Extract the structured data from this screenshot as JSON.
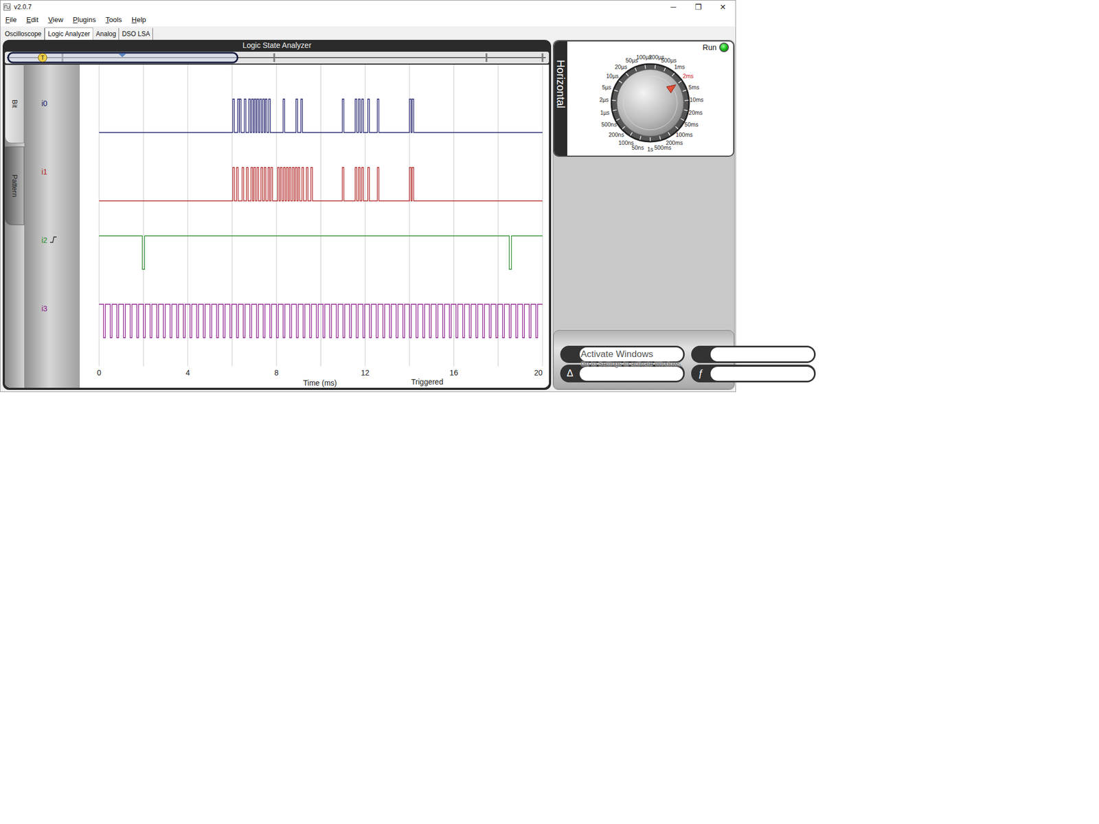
{
  "window": {
    "title": "v2.0.7",
    "controls": [
      "─",
      "❐",
      "✕"
    ]
  },
  "menu": [
    {
      "label": "File"
    },
    {
      "label": "Edit"
    },
    {
      "label": "View"
    },
    {
      "label": "Plugins"
    },
    {
      "label": "Tools"
    },
    {
      "label": "Help"
    }
  ],
  "tabs": [
    {
      "label": "Oscilloscope",
      "selected": false
    },
    {
      "label": "Logic Analyzer",
      "selected": true
    },
    {
      "label": "Analog",
      "selected": false
    },
    {
      "label": "DSO LSA",
      "selected": false
    }
  ],
  "analyzer": {
    "title": "Logic State Analyzer",
    "trigger_marker": "T",
    "side_tabs": [
      {
        "label": "Bit",
        "selected": true
      },
      {
        "label": "Pattern",
        "selected": false
      }
    ],
    "channels": [
      {
        "name": "i0",
        "color": "#1c1c6b",
        "idle": "low",
        "trigger": false,
        "pulse_width": 0.07,
        "pulse_starts": [
          6.03,
          6.25,
          6.33,
          6.55,
          6.75,
          6.88,
          7.0,
          7.12,
          7.25,
          7.38,
          7.5,
          7.65,
          8.3,
          8.88,
          9.1,
          10.97,
          11.55,
          11.7,
          11.85,
          12.12,
          12.55,
          14.0,
          14.12
        ]
      },
      {
        "name": "i1",
        "color": "#b02222",
        "idle": "low",
        "trigger": false,
        "pulse_width": 0.07,
        "pulse_starts": [
          6.03,
          6.2,
          6.45,
          6.65,
          6.85,
          6.98,
          7.12,
          7.3,
          7.45,
          7.62,
          7.75,
          8.05,
          8.18,
          8.32,
          8.45,
          8.58,
          8.72,
          8.85,
          8.98,
          9.15,
          9.35,
          9.55,
          10.97,
          11.55,
          11.7,
          11.85,
          12.12,
          12.55,
          14.0,
          14.12
        ]
      },
      {
        "name": "i2",
        "color": "#2a8a2a",
        "idle": "high",
        "trigger": true,
        "pulse_width": 0.1,
        "pulse_starts": [
          1.95,
          18.5
        ]
      },
      {
        "name": "i3",
        "color": "#8b1a8b",
        "idle": "high",
        "trigger": false,
        "pulse_width": 0.08,
        "pulse_starts": [
          0.2,
          0.5,
          0.8,
          1.1,
          1.4,
          1.7,
          2.0,
          2.3,
          2.6,
          2.9,
          3.2,
          3.5,
          3.8,
          4.1,
          4.4,
          4.7,
          5.0,
          5.3,
          5.6,
          5.9,
          6.2,
          6.5,
          6.8,
          7.1,
          7.4,
          7.7,
          8.0,
          8.3,
          8.6,
          8.9,
          9.2,
          9.5,
          9.8,
          10.1,
          10.4,
          10.7,
          11.0,
          11.3,
          11.6,
          11.9,
          12.2,
          12.5,
          12.8,
          13.1,
          13.4,
          13.7,
          14.0,
          14.3,
          14.6,
          14.9,
          15.2,
          15.5,
          15.8,
          16.1,
          16.4,
          16.7,
          17.0,
          17.3,
          17.6,
          17.9,
          18.2,
          18.5,
          18.8,
          19.1,
          19.4,
          19.7
        ]
      }
    ],
    "x_axis": {
      "title": "Time (ms)",
      "ticks": [
        "0",
        "4",
        "8",
        "12",
        "16",
        "20"
      ],
      "range": 20,
      "grid_step": 2
    },
    "status": "Triggered"
  },
  "horizontal": {
    "title": "Horizontal",
    "run_label": "Run",
    "running": true,
    "timebases": [
      {
        "label": "50ns",
        "selected": false
      },
      {
        "label": "100ns",
        "selected": false
      },
      {
        "label": "200ns",
        "selected": false
      },
      {
        "label": "500ns",
        "selected": false
      },
      {
        "label": "1µs",
        "selected": false
      },
      {
        "label": "2µs",
        "selected": false
      },
      {
        "label": "5µs",
        "selected": false
      },
      {
        "label": "10µs",
        "selected": false
      },
      {
        "label": "20µs",
        "selected": false
      },
      {
        "label": "50µs",
        "selected": false
      },
      {
        "label": "100µs",
        "selected": false
      },
      {
        "label": "200µs",
        "selected": false
      },
      {
        "label": "500µs",
        "selected": false
      },
      {
        "label": "1ms",
        "selected": false
      },
      {
        "label": "2ms",
        "selected": true
      },
      {
        "label": "5ms",
        "selected": false
      },
      {
        "label": "10ms",
        "selected": false
      },
      {
        "label": "20ms",
        "selected": false
      },
      {
        "label": "50ms",
        "selected": false
      },
      {
        "label": "100ms",
        "selected": false
      },
      {
        "label": "200ms",
        "selected": false
      },
      {
        "label": "500ms",
        "selected": false
      },
      {
        "label": "1s",
        "selected": false
      }
    ]
  },
  "readouts": [
    {
      "label": "",
      "value": ""
    },
    {
      "label": "",
      "value": ""
    },
    {
      "label": "Δ",
      "value": ""
    },
    {
      "label": "ƒ",
      "value": ""
    }
  ],
  "watermark": [
    "Activate Windows",
    "Go to Settings to activate Windows."
  ]
}
